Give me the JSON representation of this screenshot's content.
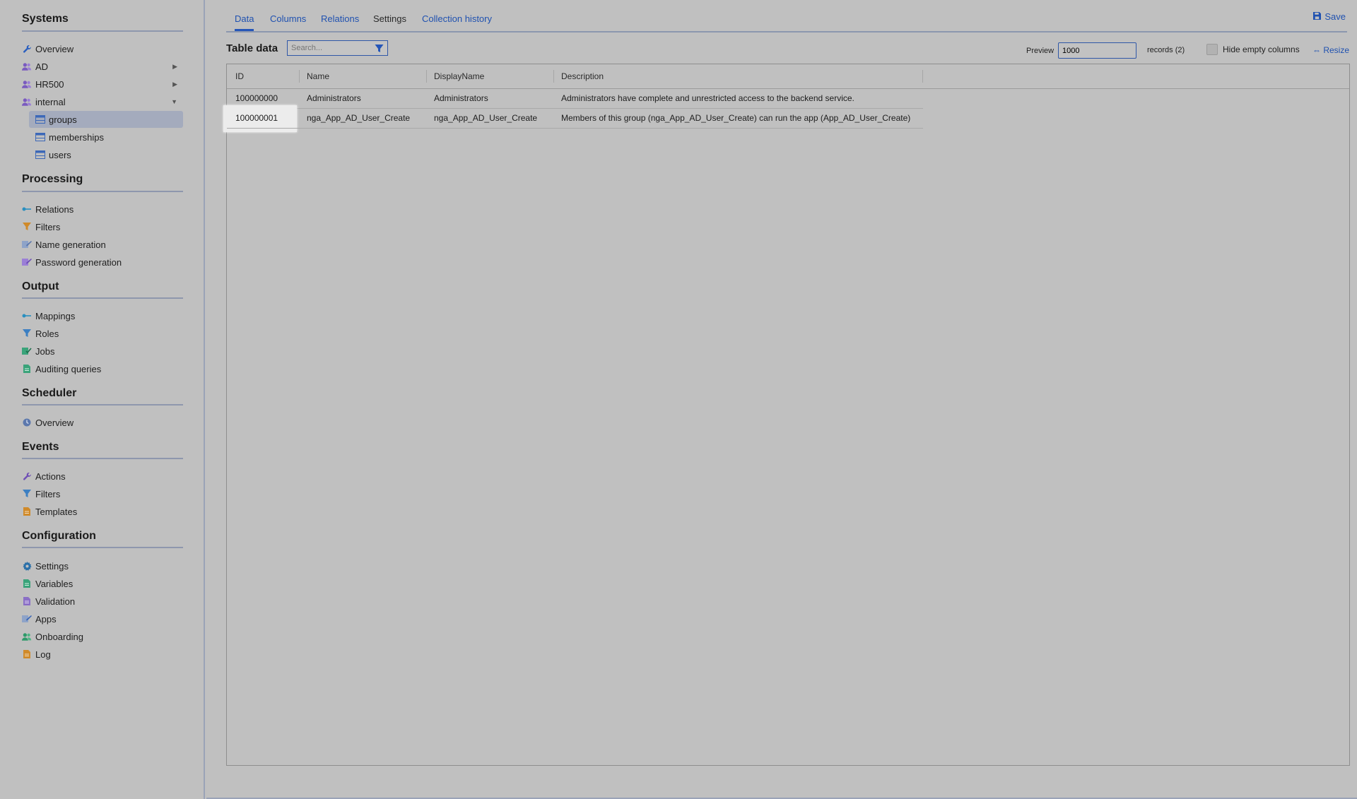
{
  "sidebar": {
    "sections": [
      {
        "title": "Systems"
      },
      {
        "title": "Processing"
      },
      {
        "title": "Output"
      },
      {
        "title": "Scheduler"
      },
      {
        "title": "Events"
      },
      {
        "title": "Configuration"
      }
    ],
    "systems": {
      "overview": "Overview",
      "ad": "AD",
      "hr500": "HR500",
      "internal": "internal",
      "groups": "groups",
      "memberships": "memberships",
      "users": "users"
    },
    "processing": {
      "relations": "Relations",
      "filters": "Filters",
      "name_generation": "Name generation",
      "password_generation": "Password generation"
    },
    "output": {
      "mappings": "Mappings",
      "roles": "Roles",
      "jobs": "Jobs",
      "auditing_queries": "Auditing queries"
    },
    "scheduler": {
      "overview": "Overview"
    },
    "events": {
      "actions": "Actions",
      "filters": "Filters",
      "templates": "Templates"
    },
    "configuration": {
      "settings": "Settings",
      "variables": "Variables",
      "validation": "Validation",
      "apps": "Apps",
      "onboarding": "Onboarding",
      "log": "Log"
    }
  },
  "tabs": {
    "data": "Data",
    "columns": "Columns",
    "relations": "Relations",
    "settings": "Settings",
    "collection_history": "Collection history"
  },
  "toolbar": {
    "save_label": "Save",
    "table_title": "Table data",
    "search_placeholder": "Search...",
    "preview_label": "Preview",
    "preview_value": "1000",
    "records_label": "records (2)",
    "hide_empty_label": "Hide empty columns",
    "resize_label": "Resize"
  },
  "table": {
    "headers": {
      "id": "ID",
      "name": "Name",
      "display_name": "DisplayName",
      "description": "Description"
    },
    "rows": [
      {
        "id": "100000000",
        "name": "Administrators",
        "display_name": "Administrators",
        "description": "Administrators have complete and unrestricted access to the backend service."
      },
      {
        "id": "100000001",
        "name": "nga_App_AD_User_Create",
        "display_name": "nga_App_AD_User_Create",
        "description": "Members of this group (nga_App_AD_User_Create) can run the app (App_AD_User_Create)"
      }
    ]
  },
  "colors": {
    "accent": "#1f51b0",
    "background": "#c0c0c0",
    "active_nav": "#a4abbd"
  }
}
